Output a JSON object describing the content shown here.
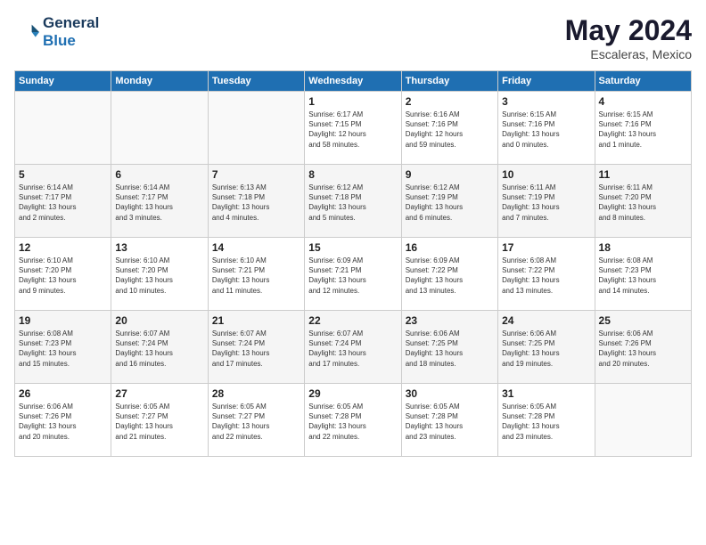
{
  "header": {
    "logo_line1": "General",
    "logo_line2": "Blue",
    "month": "May 2024",
    "location": "Escaleras, Mexico"
  },
  "weekdays": [
    "Sunday",
    "Monday",
    "Tuesday",
    "Wednesday",
    "Thursday",
    "Friday",
    "Saturday"
  ],
  "weeks": [
    [
      {
        "day": "",
        "info": ""
      },
      {
        "day": "",
        "info": ""
      },
      {
        "day": "",
        "info": ""
      },
      {
        "day": "1",
        "info": "Sunrise: 6:17 AM\nSunset: 7:15 PM\nDaylight: 12 hours\nand 58 minutes."
      },
      {
        "day": "2",
        "info": "Sunrise: 6:16 AM\nSunset: 7:16 PM\nDaylight: 12 hours\nand 59 minutes."
      },
      {
        "day": "3",
        "info": "Sunrise: 6:15 AM\nSunset: 7:16 PM\nDaylight: 13 hours\nand 0 minutes."
      },
      {
        "day": "4",
        "info": "Sunrise: 6:15 AM\nSunset: 7:16 PM\nDaylight: 13 hours\nand 1 minute."
      }
    ],
    [
      {
        "day": "5",
        "info": "Sunrise: 6:14 AM\nSunset: 7:17 PM\nDaylight: 13 hours\nand 2 minutes."
      },
      {
        "day": "6",
        "info": "Sunrise: 6:14 AM\nSunset: 7:17 PM\nDaylight: 13 hours\nand 3 minutes."
      },
      {
        "day": "7",
        "info": "Sunrise: 6:13 AM\nSunset: 7:18 PM\nDaylight: 13 hours\nand 4 minutes."
      },
      {
        "day": "8",
        "info": "Sunrise: 6:12 AM\nSunset: 7:18 PM\nDaylight: 13 hours\nand 5 minutes."
      },
      {
        "day": "9",
        "info": "Sunrise: 6:12 AM\nSunset: 7:19 PM\nDaylight: 13 hours\nand 6 minutes."
      },
      {
        "day": "10",
        "info": "Sunrise: 6:11 AM\nSunset: 7:19 PM\nDaylight: 13 hours\nand 7 minutes."
      },
      {
        "day": "11",
        "info": "Sunrise: 6:11 AM\nSunset: 7:20 PM\nDaylight: 13 hours\nand 8 minutes."
      }
    ],
    [
      {
        "day": "12",
        "info": "Sunrise: 6:10 AM\nSunset: 7:20 PM\nDaylight: 13 hours\nand 9 minutes."
      },
      {
        "day": "13",
        "info": "Sunrise: 6:10 AM\nSunset: 7:20 PM\nDaylight: 13 hours\nand 10 minutes."
      },
      {
        "day": "14",
        "info": "Sunrise: 6:10 AM\nSunset: 7:21 PM\nDaylight: 13 hours\nand 11 minutes."
      },
      {
        "day": "15",
        "info": "Sunrise: 6:09 AM\nSunset: 7:21 PM\nDaylight: 13 hours\nand 12 minutes."
      },
      {
        "day": "16",
        "info": "Sunrise: 6:09 AM\nSunset: 7:22 PM\nDaylight: 13 hours\nand 13 minutes."
      },
      {
        "day": "17",
        "info": "Sunrise: 6:08 AM\nSunset: 7:22 PM\nDaylight: 13 hours\nand 13 minutes."
      },
      {
        "day": "18",
        "info": "Sunrise: 6:08 AM\nSunset: 7:23 PM\nDaylight: 13 hours\nand 14 minutes."
      }
    ],
    [
      {
        "day": "19",
        "info": "Sunrise: 6:08 AM\nSunset: 7:23 PM\nDaylight: 13 hours\nand 15 minutes."
      },
      {
        "day": "20",
        "info": "Sunrise: 6:07 AM\nSunset: 7:24 PM\nDaylight: 13 hours\nand 16 minutes."
      },
      {
        "day": "21",
        "info": "Sunrise: 6:07 AM\nSunset: 7:24 PM\nDaylight: 13 hours\nand 17 minutes."
      },
      {
        "day": "22",
        "info": "Sunrise: 6:07 AM\nSunset: 7:24 PM\nDaylight: 13 hours\nand 17 minutes."
      },
      {
        "day": "23",
        "info": "Sunrise: 6:06 AM\nSunset: 7:25 PM\nDaylight: 13 hours\nand 18 minutes."
      },
      {
        "day": "24",
        "info": "Sunrise: 6:06 AM\nSunset: 7:25 PM\nDaylight: 13 hours\nand 19 minutes."
      },
      {
        "day": "25",
        "info": "Sunrise: 6:06 AM\nSunset: 7:26 PM\nDaylight: 13 hours\nand 20 minutes."
      }
    ],
    [
      {
        "day": "26",
        "info": "Sunrise: 6:06 AM\nSunset: 7:26 PM\nDaylight: 13 hours\nand 20 minutes."
      },
      {
        "day": "27",
        "info": "Sunrise: 6:05 AM\nSunset: 7:27 PM\nDaylight: 13 hours\nand 21 minutes."
      },
      {
        "day": "28",
        "info": "Sunrise: 6:05 AM\nSunset: 7:27 PM\nDaylight: 13 hours\nand 22 minutes."
      },
      {
        "day": "29",
        "info": "Sunrise: 6:05 AM\nSunset: 7:28 PM\nDaylight: 13 hours\nand 22 minutes."
      },
      {
        "day": "30",
        "info": "Sunrise: 6:05 AM\nSunset: 7:28 PM\nDaylight: 13 hours\nand 23 minutes."
      },
      {
        "day": "31",
        "info": "Sunrise: 6:05 AM\nSunset: 7:28 PM\nDaylight: 13 hours\nand 23 minutes."
      },
      {
        "day": "",
        "info": ""
      }
    ]
  ]
}
